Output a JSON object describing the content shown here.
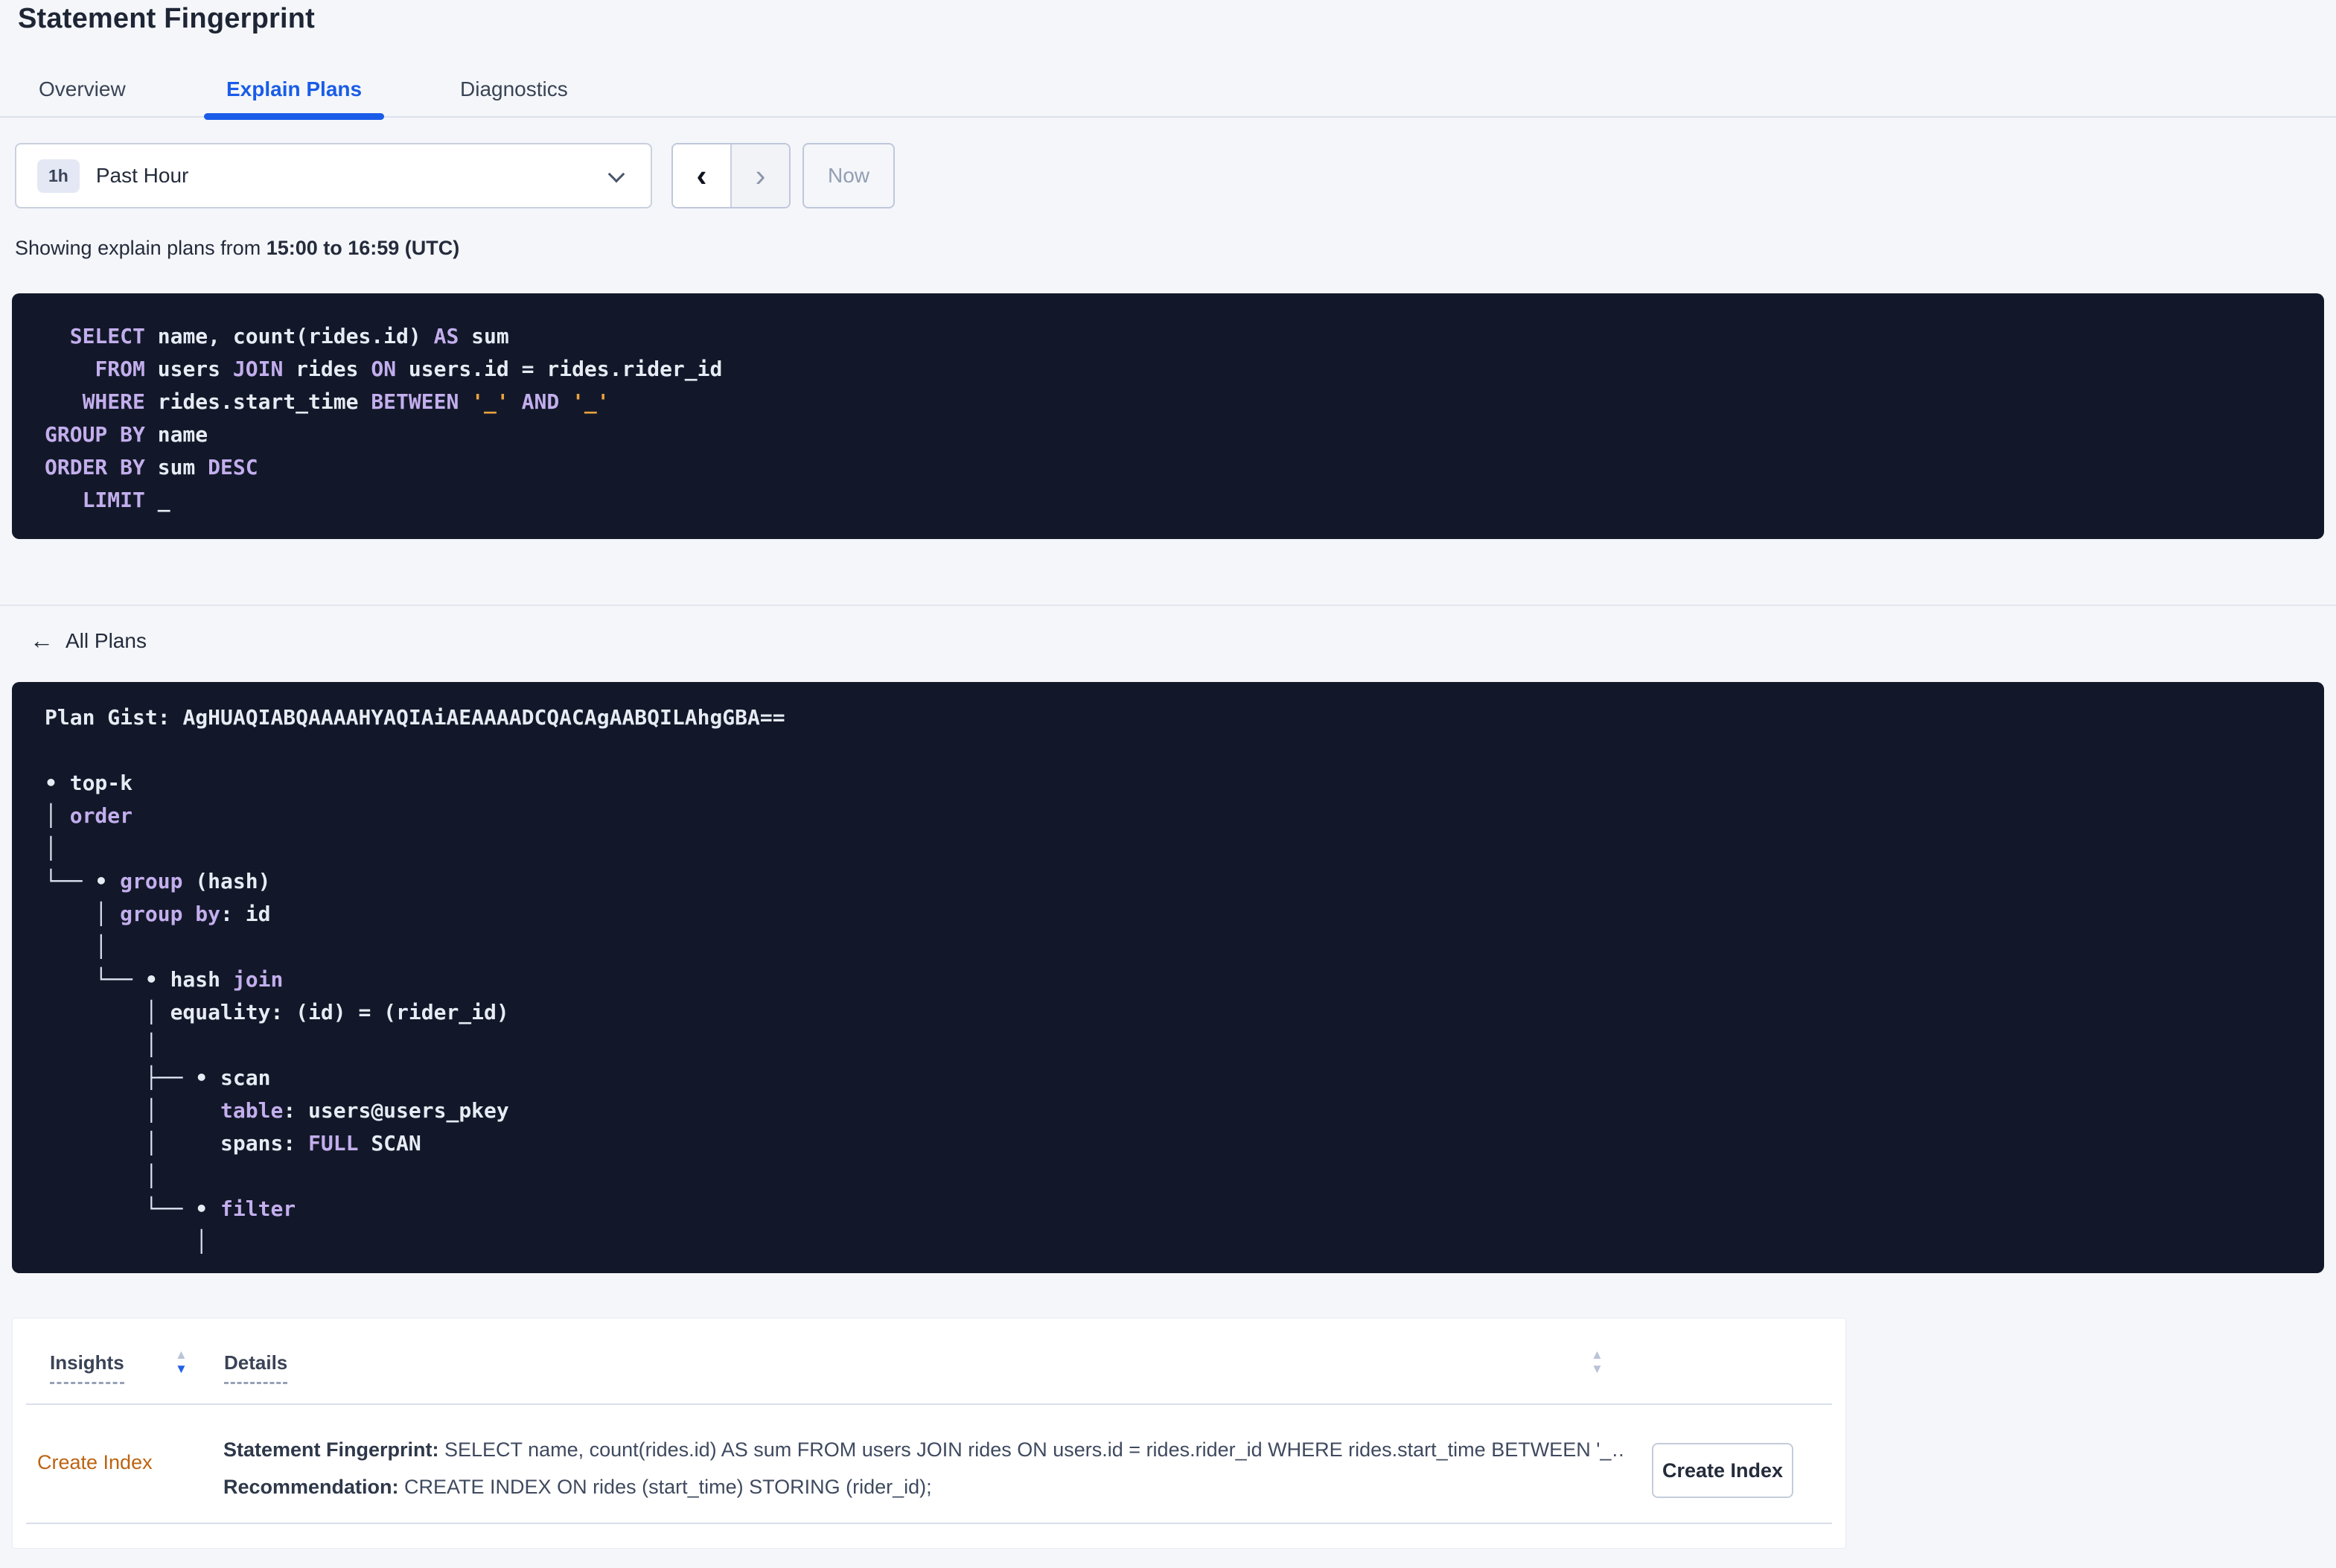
{
  "page": {
    "title": "Statement Fingerprint"
  },
  "tabs": [
    {
      "label": "Overview",
      "active": false
    },
    {
      "label": "Explain Plans",
      "active": true
    },
    {
      "label": "Diagnostics",
      "active": false
    }
  ],
  "time_picker": {
    "badge": "1h",
    "selected": "Past Hour",
    "prev_glyph": "‹",
    "next_glyph": "›",
    "now_label": "Now"
  },
  "showing": {
    "prefix": "Showing explain plans from ",
    "range_bold": "15:00 to 16:59 (UTC)"
  },
  "sql": {
    "lines": [
      [
        {
          "t": "p",
          "s": "  "
        },
        {
          "t": "k",
          "s": "SELECT"
        },
        {
          "t": "p",
          "s": " name, count(rides.id) "
        },
        {
          "t": "k",
          "s": "AS"
        },
        {
          "t": "p",
          "s": " sum"
        }
      ],
      [
        {
          "t": "p",
          "s": "    "
        },
        {
          "t": "k",
          "s": "FROM"
        },
        {
          "t": "p",
          "s": " users "
        },
        {
          "t": "k",
          "s": "JOIN"
        },
        {
          "t": "p",
          "s": " rides "
        },
        {
          "t": "k",
          "s": "ON"
        },
        {
          "t": "p",
          "s": " users.id = rides.rider_id"
        }
      ],
      [
        {
          "t": "p",
          "s": "   "
        },
        {
          "t": "k",
          "s": "WHERE"
        },
        {
          "t": "p",
          "s": " rides.start_time "
        },
        {
          "t": "k",
          "s": "BETWEEN"
        },
        {
          "t": "p",
          "s": " "
        },
        {
          "t": "l",
          "s": "'_'"
        },
        {
          "t": "p",
          "s": " "
        },
        {
          "t": "k",
          "s": "AND"
        },
        {
          "t": "p",
          "s": " "
        },
        {
          "t": "l",
          "s": "'_'"
        }
      ],
      [
        {
          "t": "k",
          "s": "GROUP BY"
        },
        {
          "t": "p",
          "s": " name"
        }
      ],
      [
        {
          "t": "k",
          "s": "ORDER BY"
        },
        {
          "t": "p",
          "s": " sum "
        },
        {
          "t": "k",
          "s": "DESC"
        }
      ],
      [
        {
          "t": "p",
          "s": "   "
        },
        {
          "t": "k",
          "s": "LIMIT"
        },
        {
          "t": "p",
          "s": " _"
        }
      ]
    ]
  },
  "back_link": {
    "arrow": "←",
    "label": "All Plans"
  },
  "plan": {
    "gist_label": "Plan Gist: ",
    "gist": "AgHUAQIABQAAAAHYAQIAiAEAAAADCQACAgAABQILAhgGBA==",
    "tree": [
      [
        {
          "t": "p",
          "s": "• top-k"
        }
      ],
      [
        {
          "t": "t",
          "s": "│ "
        },
        {
          "t": "k",
          "s": "order"
        }
      ],
      [
        {
          "t": "t",
          "s": "│"
        }
      ],
      [
        {
          "t": "t",
          "s": "└── "
        },
        {
          "t": "p",
          "s": "• "
        },
        {
          "t": "k",
          "s": "group"
        },
        {
          "t": "p",
          "s": " (hash)"
        }
      ],
      [
        {
          "t": "t",
          "s": "    │ "
        },
        {
          "t": "k",
          "s": "group by"
        },
        {
          "t": "p",
          "s": ": id"
        }
      ],
      [
        {
          "t": "t",
          "s": "    │"
        }
      ],
      [
        {
          "t": "t",
          "s": "    └── "
        },
        {
          "t": "p",
          "s": "• hash "
        },
        {
          "t": "k",
          "s": "join"
        }
      ],
      [
        {
          "t": "t",
          "s": "        │ "
        },
        {
          "t": "p",
          "s": "equality: (id) = (rider_id)"
        }
      ],
      [
        {
          "t": "t",
          "s": "        │"
        }
      ],
      [
        {
          "t": "t",
          "s": "        ├── "
        },
        {
          "t": "p",
          "s": "• scan"
        }
      ],
      [
        {
          "t": "t",
          "s": "        │     "
        },
        {
          "t": "k",
          "s": "table"
        },
        {
          "t": "p",
          "s": ": users@users_pkey"
        }
      ],
      [
        {
          "t": "t",
          "s": "        │     "
        },
        {
          "t": "p",
          "s": "spans: "
        },
        {
          "t": "k",
          "s": "FULL"
        },
        {
          "t": "p",
          "s": " SCAN"
        }
      ],
      [
        {
          "t": "t",
          "s": "        │"
        }
      ],
      [
        {
          "t": "t",
          "s": "        └── "
        },
        {
          "t": "p",
          "s": "• "
        },
        {
          "t": "k",
          "s": "filter"
        }
      ],
      [
        {
          "t": "t",
          "s": "            │"
        }
      ]
    ]
  },
  "insights_table": {
    "columns": [
      {
        "label": "Insights"
      },
      {
        "label": "Details"
      }
    ],
    "sort_glyphs": {
      "up": "▲",
      "down": "▼"
    },
    "rows": [
      {
        "insight": "Create Index",
        "details": [
          {
            "label": "Statement Fingerprint:",
            "text": "SELECT name, count(rides.id) AS sum FROM users JOIN rides ON users.id = rides.rider_id WHERE rides.start_time BETWEEN '_…"
          },
          {
            "label": "Recommendation:",
            "text": "CREATE INDEX ON rides (start_time) STORING (rider_id);"
          }
        ],
        "action_label": "Create Index"
      }
    ]
  },
  "colors": {
    "accent_blue": "#1A5CE8",
    "keyword_purple": "#C3AEED",
    "literal_orange": "#EBA23F",
    "insight_link_orange": "#BD6411",
    "code_background": "#121829",
    "page_background": "#F4F6FA"
  }
}
